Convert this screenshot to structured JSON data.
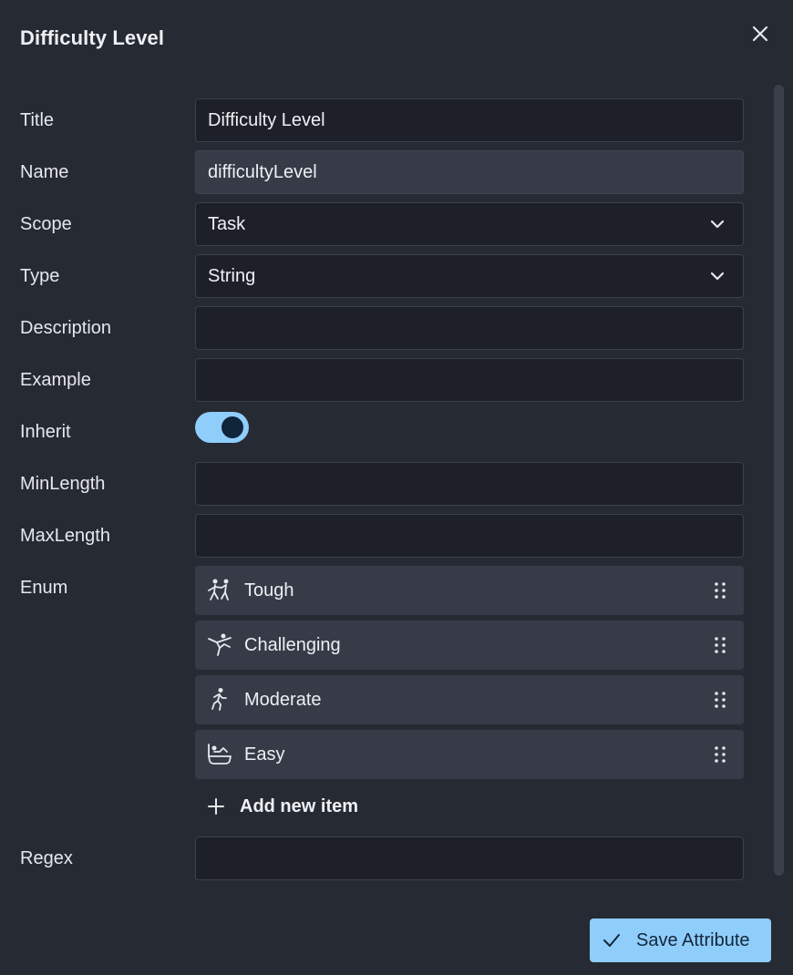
{
  "dialog": {
    "title": "Difficulty Level",
    "close_icon": "close-icon"
  },
  "fields": {
    "title": {
      "label": "Title",
      "value": "Difficulty Level"
    },
    "name": {
      "label": "Name",
      "value": "difficultyLevel"
    },
    "scope": {
      "label": "Scope",
      "value": "Task",
      "icon": "chevron-down-icon"
    },
    "type": {
      "label": "Type",
      "value": "String",
      "icon": "chevron-down-icon"
    },
    "description": {
      "label": "Description",
      "value": ""
    },
    "example": {
      "label": "Example",
      "value": ""
    },
    "inherit": {
      "label": "Inherit",
      "checked": true
    },
    "minlength": {
      "label": "MinLength",
      "value": ""
    },
    "maxlength": {
      "label": "MaxLength",
      "value": ""
    },
    "enum": {
      "label": "Enum",
      "items": [
        {
          "label": "Tough",
          "icon": "wrestling-icon"
        },
        {
          "label": "Challenging",
          "icon": "martial-arts-kick-icon"
        },
        {
          "label": "Moderate",
          "icon": "running-icon"
        },
        {
          "label": "Easy",
          "icon": "bathtub-icon"
        }
      ],
      "add_label": "Add new item"
    },
    "regex": {
      "label": "Regex",
      "value": ""
    }
  },
  "footer": {
    "save_label": "Save Attribute"
  },
  "colors": {
    "background": "#262a33",
    "input_bg": "#1d2028",
    "item_bg": "#363b47",
    "accent": "#8fcdfb"
  }
}
